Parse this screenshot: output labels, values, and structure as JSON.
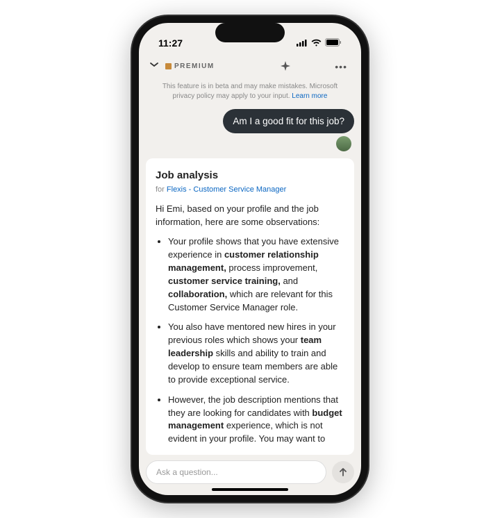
{
  "status": {
    "time": "11:27"
  },
  "nav": {
    "premium_label": "PREMIUM"
  },
  "beta": {
    "text_a": "This feature is in beta and may make mistakes. Microsoft privacy policy may apply to your input. ",
    "link": "Learn more"
  },
  "chat": {
    "user_msg": "Am I a good fit for this job?"
  },
  "card": {
    "title": "Job analysis",
    "for_prefix": "for ",
    "for_company": "Flexis - Customer Service Manager",
    "intro": "Hi Emi, based on your profile and the job information, here are some observations:",
    "b1_a": "Your profile shows that you have extensive experience in ",
    "b1_s1": "customer relationship management,",
    "b1_b": " process improvement, ",
    "b1_s2": "customer service training,",
    "b1_c": " and ",
    "b1_s3": "collaboration,",
    "b1_d": " which are relevant for this Customer Service Manager role.",
    "b2_a": "You also have mentored new hires in your previous roles which shows your ",
    "b2_s1": "team leadership",
    "b2_b": " skills and ability to train and develop to ensure team members are able to provide exceptional service.",
    "b3_a": "However, the job description mentions that they are looking for candidates with ",
    "b3_s1": "budget management",
    "b3_b": " experience, which is not evident in your profile. You may want to"
  },
  "input": {
    "placeholder": "Ask a question..."
  }
}
